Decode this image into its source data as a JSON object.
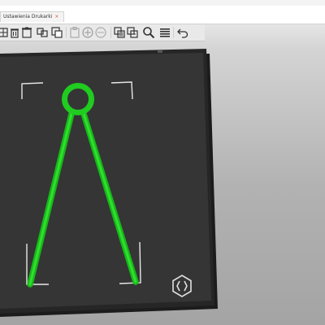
{
  "window": {
    "tab_label": "Ustawienia Drukarki",
    "tab_close": "×"
  },
  "toolbar": {
    "icons": [
      "transform-icon",
      "delete-icon",
      "delete-all-icon",
      "arrange-icon",
      "copy-icon",
      "paste-icon",
      "add-instance-icon",
      "remove-instance-icon",
      "split-icon",
      "variable-layer-height-icon",
      "search-icon",
      "layers-icon",
      "undo-icon"
    ]
  },
  "scene": {
    "bed_color": "#353535",
    "model_color": "#1fcc1f",
    "logo": "prusa-logo-icon"
  }
}
